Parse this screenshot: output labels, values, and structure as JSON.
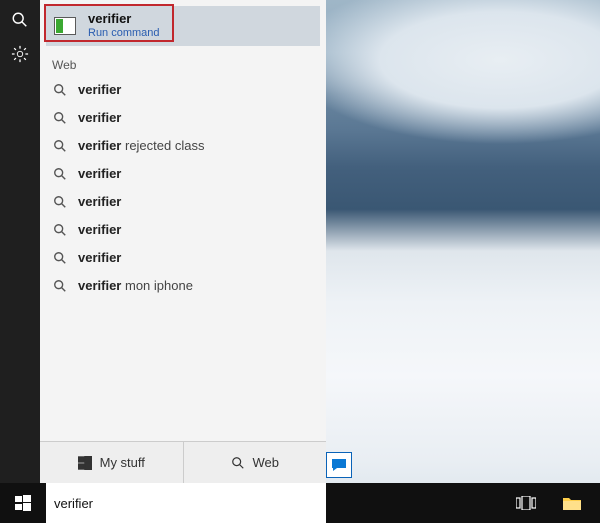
{
  "best_match": {
    "title": "verifier",
    "subtitle": "Run command"
  },
  "sections": {
    "web_label": "Web"
  },
  "suggestions": [
    {
      "bold": "verifier",
      "rest": ""
    },
    {
      "bold": "verifier",
      "rest": ""
    },
    {
      "bold": "verifier",
      "rest": " rejected class"
    },
    {
      "bold": "verifier",
      "rest": ""
    },
    {
      "bold": "verifier",
      "rest": ""
    },
    {
      "bold": "verifier",
      "rest": ""
    },
    {
      "bold": "verifier",
      "rest": ""
    },
    {
      "bold": "verifier",
      "rest": " mon iphone"
    }
  ],
  "panel_buttons": {
    "my_stuff": "My stuff",
    "web": "Web"
  },
  "search_query": "verifier"
}
